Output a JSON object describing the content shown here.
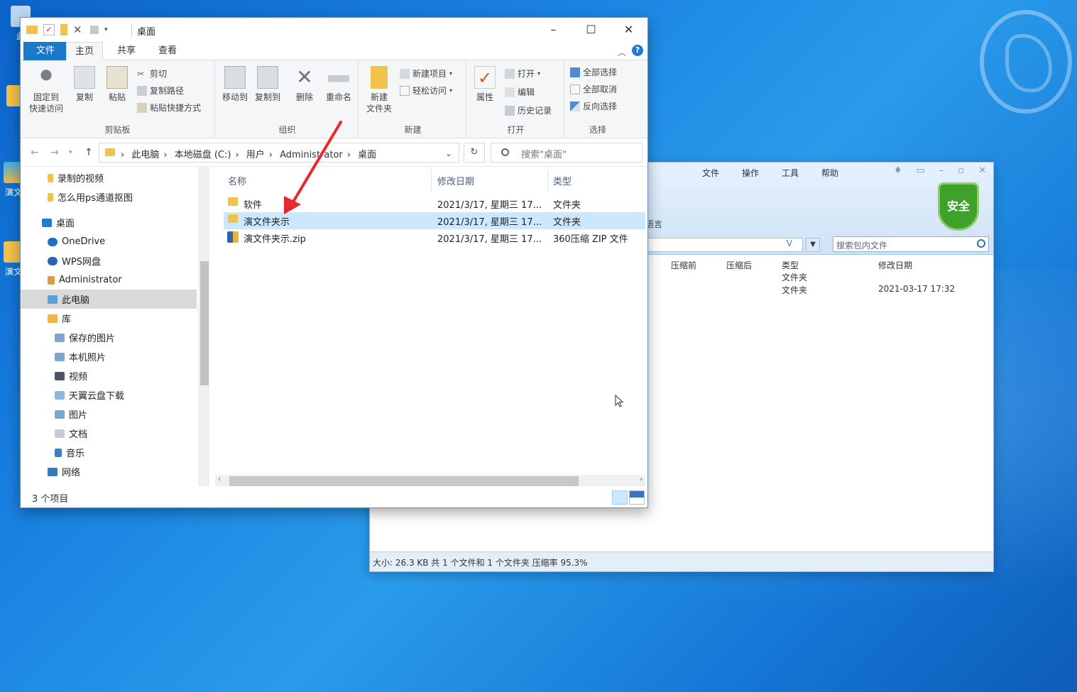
{
  "desktop": {
    "icons": [
      {
        "label": "此"
      },
      {
        "label": "演文"
      },
      {
        "label": "演文"
      }
    ]
  },
  "zip": {
    "menu": [
      "文件",
      "操作",
      "工具",
      "帮助"
    ],
    "lang_fragment": "语言",
    "shield_label": "安全",
    "address_suffix": "V",
    "search_placeholder": "搜索包内文件",
    "columns": {
      "before": "压缩前",
      "after": "压缩后",
      "type": "类型",
      "date": "修改日期"
    },
    "rows": [
      {
        "type": "文件夹",
        "date": ""
      },
      {
        "type": "文件夹",
        "date": "2021-03-17 17:32"
      }
    ],
    "status": "大小: 26.3 KB 共 1 个文件和 1 个文件夹 压缩率 95.3%"
  },
  "explorer": {
    "title": "桌面",
    "tabs": {
      "file": "文件",
      "home": "主页",
      "share": "共享",
      "view": "查看"
    },
    "ribbon": {
      "clipboard": {
        "group": "剪贴板",
        "pin_line1": "固定到",
        "pin_line2": "快速访问",
        "copy": "复制",
        "paste": "粘贴",
        "cut": "剪切",
        "copy_path": "复制路径",
        "paste_shortcut": "粘贴快捷方式"
      },
      "organize": {
        "group": "组织",
        "move_to": "移动到",
        "copy_to": "复制到",
        "delete": "删除",
        "rename": "重命名"
      },
      "new": {
        "group": "新建",
        "new_folder_line1": "新建",
        "new_folder_line2": "文件夹",
        "new_item": "新建项目",
        "easy_access": "轻松访问"
      },
      "open": {
        "group": "打开",
        "properties": "属性",
        "open": "打开",
        "edit": "编辑",
        "history": "历史记录"
      },
      "select": {
        "group": "选择",
        "select_all": "全部选择",
        "select_none": "全部取消",
        "invert": "反向选择"
      }
    },
    "address": {
      "crumbs": [
        "此电脑",
        "本地磁盘 (C:)",
        "用户",
        "Administrator",
        "桌面"
      ],
      "search_placeholder": "搜索\"桌面\""
    },
    "nav": [
      {
        "label": "录制的视频"
      },
      {
        "label": "怎么用ps通道抠图"
      },
      {
        "label": "桌面"
      },
      {
        "label": "OneDrive"
      },
      {
        "label": "WPS网盘"
      },
      {
        "label": "Administrator"
      },
      {
        "label": "此电脑"
      },
      {
        "label": "库"
      },
      {
        "label": "保存的图片"
      },
      {
        "label": "本机照片"
      },
      {
        "label": "视频"
      },
      {
        "label": "天翼云盘下载"
      },
      {
        "label": "图片"
      },
      {
        "label": "文档"
      },
      {
        "label": "音乐"
      },
      {
        "label": "网络"
      }
    ],
    "columns": {
      "name": "名称",
      "date": "修改日期",
      "type": "类型"
    },
    "files": [
      {
        "name": "软件",
        "date": "2021/3/17, 星期三 17...",
        "type": "文件夹"
      },
      {
        "name": "演文件夹示",
        "date": "2021/3/17, 星期三 17...",
        "type": "文件夹"
      },
      {
        "name": "演文件夹示.zip",
        "date": "2021/3/17, 星期三 17...",
        "type": "360压缩 ZIP 文件"
      }
    ],
    "status": "3 个项目"
  }
}
